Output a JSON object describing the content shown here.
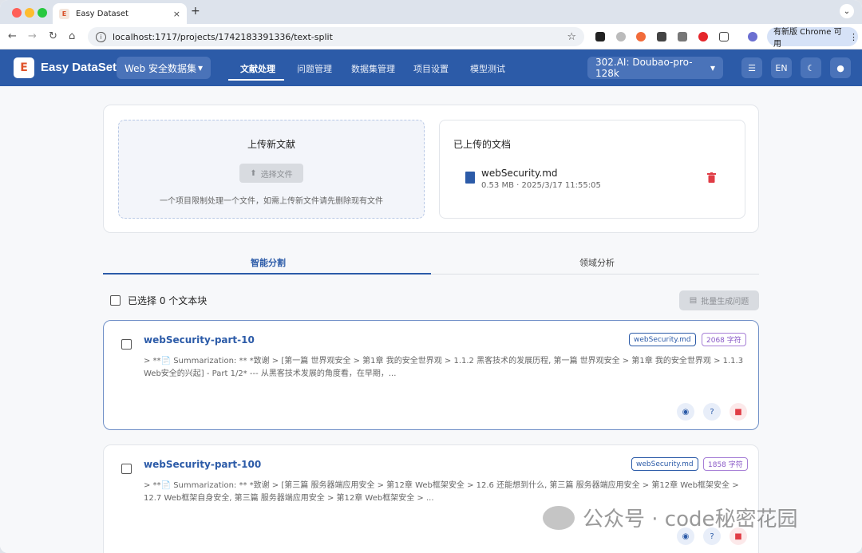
{
  "browser": {
    "tab_title": "Easy Dataset",
    "tab_close": "×",
    "new_tab": "+",
    "url": "localhost:1717/projects/1742183391336/text-split",
    "update_label": "有新版 Chrome 可用",
    "nav": {
      "back": "←",
      "forward": "→",
      "reload": "↻",
      "home": "⌂",
      "star": "☆",
      "menu": "⋮"
    }
  },
  "header": {
    "brand": "Easy DataSet",
    "project": "Web 安全数据集",
    "tabs": [
      "文献处理",
      "问题管理",
      "数据集管理",
      "项目设置",
      "模型测试"
    ],
    "active_tab": "文献处理",
    "model": "302.AI: Doubao-pro-128k",
    "lang": "EN"
  },
  "upload": {
    "title": "上传新文献",
    "button": "选择文件",
    "hint": "一个项目限制处理一个文件，如需上传新文件请先删除现有文件"
  },
  "uploaded": {
    "title": "已上传的文档",
    "file_name": "webSecurity.md",
    "file_meta": "0.53 MB · 2025/3/17 11:55:05"
  },
  "tabs": {
    "active": "智能分割",
    "inactive": "领域分析"
  },
  "selection": {
    "label": "已选择 0 个文本块",
    "batch_button": "批量生成问题"
  },
  "chunks": [
    {
      "title": "webSecurity-part-10",
      "file": "webSecurity.md",
      "chars": "2068 字符",
      "body": "> **📄 Summarization: ** *致谢 > [第一篇 世界观安全 > 第1章 我的安全世界观 > 1.1.2 黑客技术的发展历程, 第一篇 世界观安全 > 第1章 我的安全世界观 > 1.1.3 Web安全的兴起] - Part 1/2* --- 从黑客技术发展的角度看，在早期，..."
    },
    {
      "title": "webSecurity-part-100",
      "file": "webSecurity.md",
      "chars": "1858 字符",
      "body": "> **📄 Summarization: ** *致谢 > [第三篇 服务器端应用安全 > 第12章 Web框架安全 > 12.6 还能想到什么, 第三篇 服务器端应用安全 > 第12章 Web框架安全 > 12.7 Web框架自身安全, 第三篇 服务器端应用安全 > 第12章 Web框架安全 > ..."
    }
  ],
  "watermark": "公众号 · code秘密花园"
}
